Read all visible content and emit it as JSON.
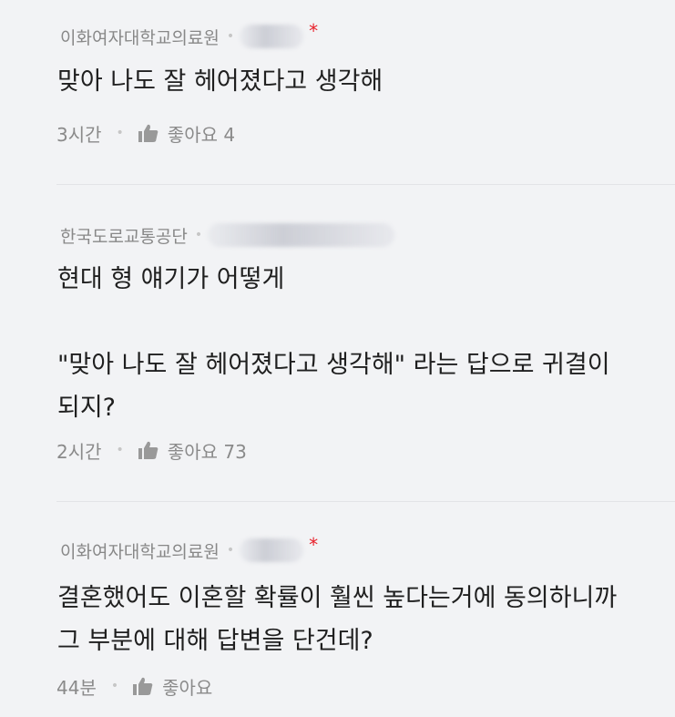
{
  "comments": [
    {
      "author": "이화여자대학교의료원",
      "has_star": true,
      "star": "*",
      "text": "맞아 나도 잘 헤어졌다고 생각해",
      "time": "3시간",
      "like_label": "좋아요 4"
    },
    {
      "author": "한국도로교통공단",
      "has_star": false,
      "text": "현대 형 얘기가 어떻게\n\n\"맞아 나도 잘 헤어졌다고 생각해\" 라는 답으로 귀결이\n되지?",
      "time": "2시간",
      "like_label": "좋아요 73"
    },
    {
      "author": "이화여자대학교의료원",
      "has_star": true,
      "star": "*",
      "text": "결혼했어도 이혼할 확률이 훨씬 높다는거에 동의하니까\n그 부분에 대해 답변을 단건데?",
      "time": "44분",
      "like_label": "좋아요"
    }
  ],
  "icons": {
    "like": "thumbs-up-icon"
  },
  "colors": {
    "background": "#f2f3f5",
    "star": "#e8212b",
    "meta": "#888888"
  }
}
